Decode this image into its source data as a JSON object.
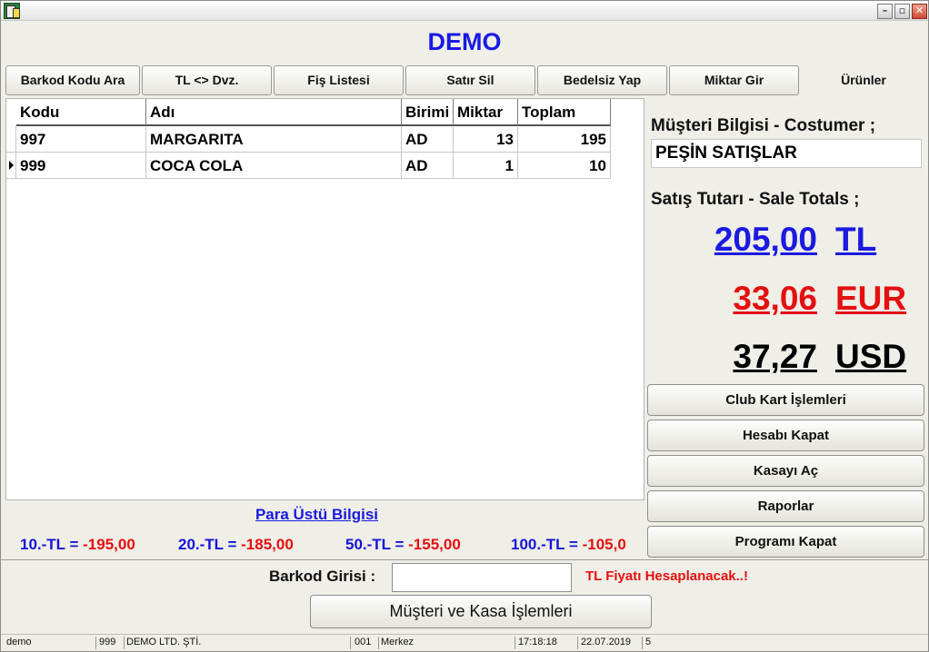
{
  "window": {
    "title": ""
  },
  "app_title": "DEMO",
  "tabs": [
    "Barkod Kodu Ara",
    "TL <> Dvz.",
    "Fiş Listesi",
    "Satır Sil",
    "Bedelsiz Yap",
    "Miktar Gir",
    "Ürünler"
  ],
  "grid": {
    "columns": [
      "Kodu",
      "Adı",
      "Birimi",
      "Miktar",
      "Toplam"
    ],
    "rows": [
      {
        "kodu": "997",
        "adi": "MARGARITA",
        "birimi": "AD",
        "miktar": "13",
        "toplam": "195"
      },
      {
        "kodu": "999",
        "adi": "COCA COLA",
        "birimi": "AD",
        "miktar": "1",
        "toplam": "10"
      }
    ]
  },
  "change_info": {
    "title": "Para Üstü Bilgisi",
    "items": [
      {
        "denom": "10.-TL =",
        "value": "-195,00"
      },
      {
        "denom": "20.-TL =",
        "value": "-185,00"
      },
      {
        "denom": "50.-TL =",
        "value": "-155,00"
      },
      {
        "denom": "100.-TL =",
        "value": "-105,0"
      }
    ]
  },
  "customer": {
    "title": "Müşteri Bilgisi - Costumer ;",
    "value": "PEŞİN SATIŞLAR"
  },
  "totals": {
    "title": "Satış Tutarı  -  Sale Totals ;",
    "tl": {
      "amount": "205,00",
      "currency": "TL",
      "color": "#1a1ae0"
    },
    "eur": {
      "amount": "33,06",
      "currency": "EUR",
      "color": "#e41010"
    },
    "usd": {
      "amount": "37,27",
      "currency": "USD",
      "color": "#000000"
    }
  },
  "side_buttons": [
    "Club Kart İşlemleri",
    "Hesabı Kapat",
    "Kasayı Aç",
    "Raporlar",
    "Programı Kapat"
  ],
  "barcode": {
    "label": "Barkod Girisi :",
    "value": "",
    "note": "TL Fiyatı Hesaplanacak..!"
  },
  "customer_cash_button": "Müşteri ve Kasa İşlemleri",
  "statusbar": {
    "user": "demo",
    "company_code": "999",
    "company_name": "DEMO LTD. ŞTİ.",
    "branch_code": "001",
    "branch_name": "Merkez",
    "time": "17:18:18",
    "date": "22.07.2019",
    "count": "5"
  }
}
